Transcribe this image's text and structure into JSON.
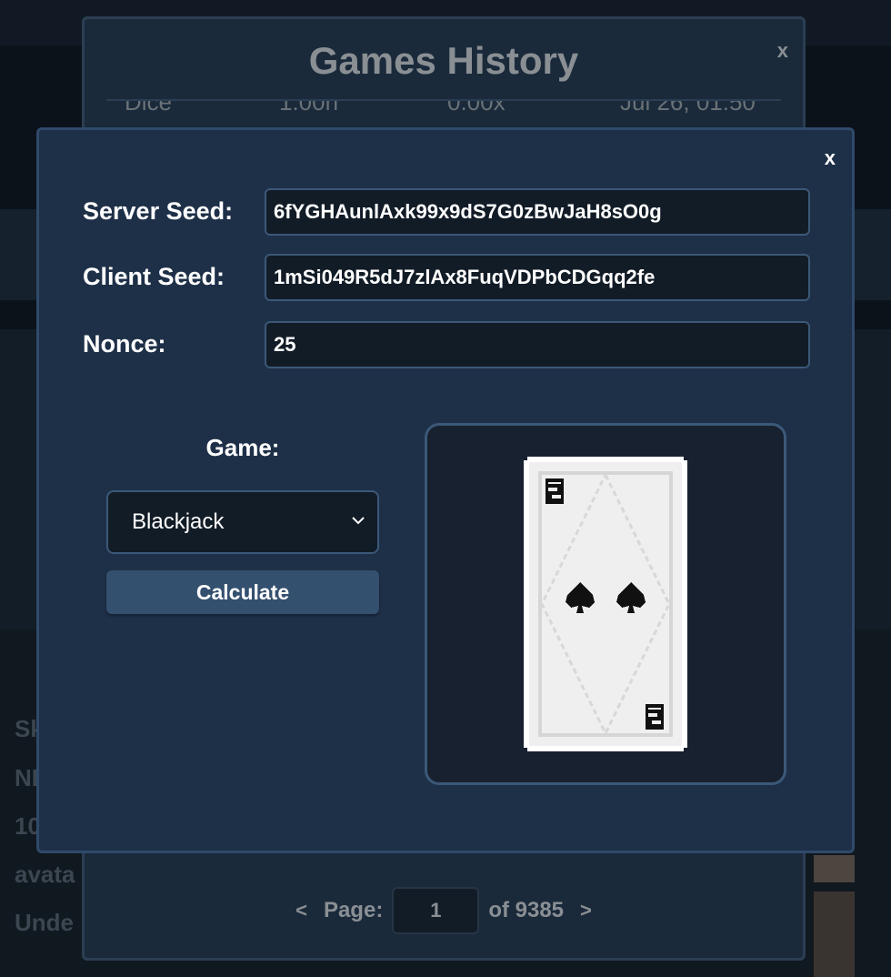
{
  "history": {
    "title": "Games History",
    "close_label": "x",
    "peek_row": {
      "game": "Dice",
      "target": "1.00h",
      "multiplier": "0.00x",
      "date": "Jul 26, 01:50"
    }
  },
  "pager": {
    "prev_label": "<",
    "page_label": "Page:",
    "current_page": "1",
    "total_label": "of 9385",
    "next_label": ">"
  },
  "fairness": {
    "close_label": "x",
    "server_seed_label": "Server Seed:",
    "server_seed_value": "6fYGHAunlAxk99x9dS7G0zBwJaH8sO0g",
    "client_seed_label": "Client Seed:",
    "client_seed_value": "1mSi049R5dJ7zlAx8FuqVDPbCDGqq2fe",
    "nonce_label": "Nonce:",
    "nonce_value": "25",
    "game_label": "Game:",
    "game_selected": "Blackjack",
    "calculate_label": "Calculate"
  },
  "result": {
    "card_rank": "2",
    "card_suit": "spades",
    "suit_icon": "spade-icon"
  },
  "background": {
    "side_text": [
      "Sk",
      "NI",
      "10",
      "avata",
      "Unde"
    ]
  },
  "colors": {
    "modal_bg": "#1e3048",
    "input_bg": "#121c27",
    "input_border": "#3b5878",
    "button_bg": "#34506f",
    "history_bg": "#1a2a3b"
  }
}
